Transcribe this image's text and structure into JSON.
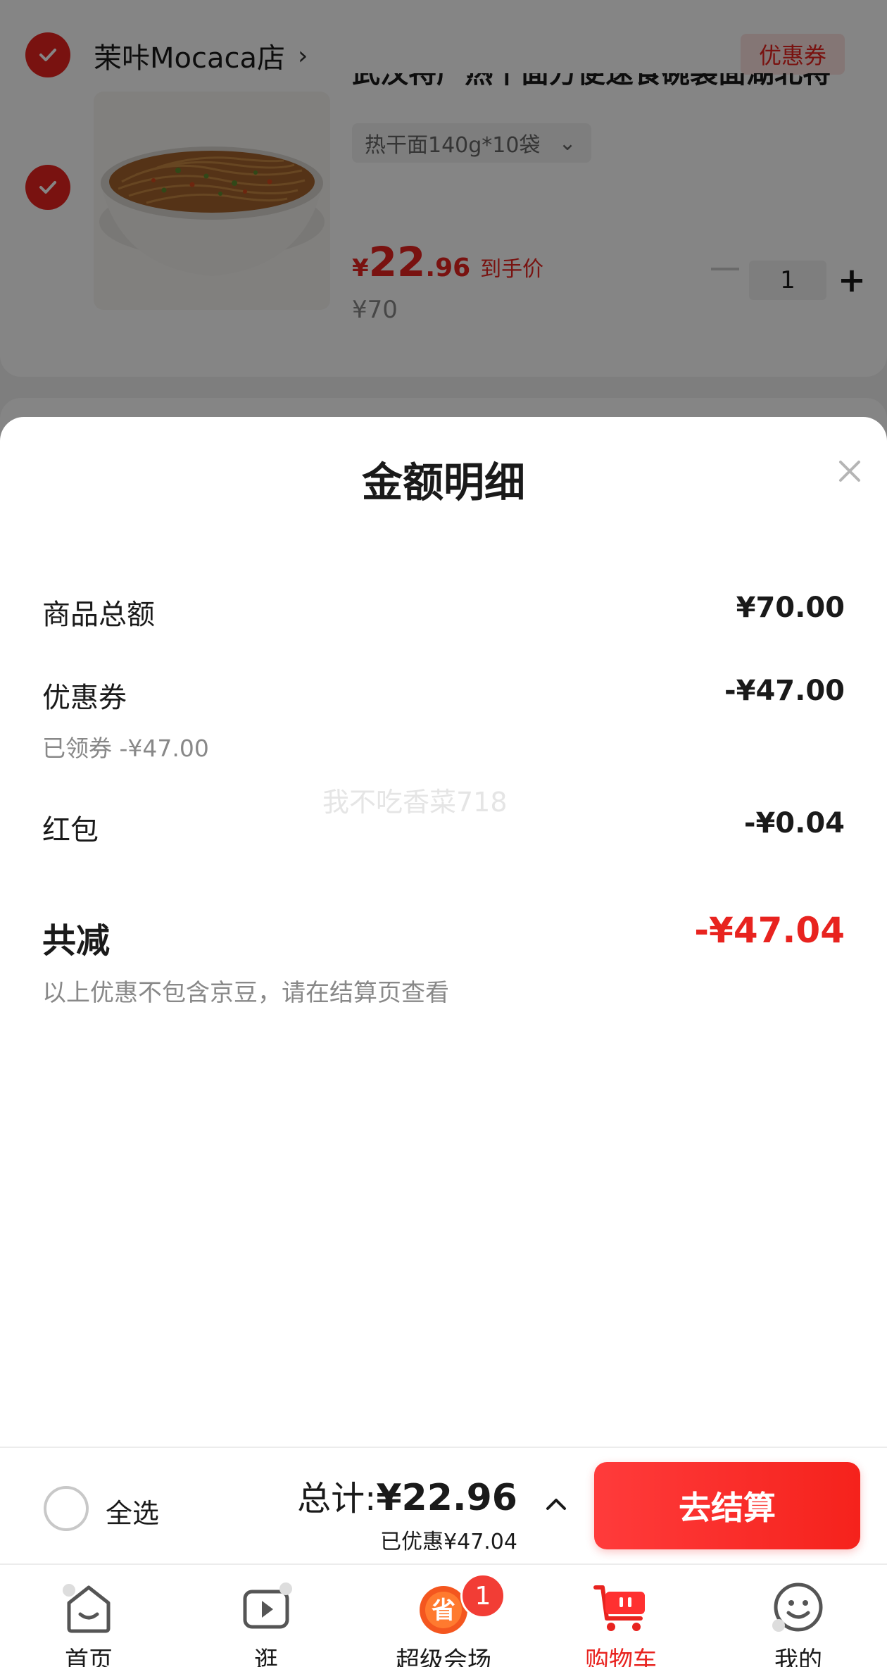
{
  "store": {
    "name": "茉咔Mocaca店",
    "chevron": "›",
    "coupon_tag": "优惠券"
  },
  "product": {
    "title": "武汉特产热干面方便速食碗装面湖北特",
    "spec": "热干面140g*10袋",
    "spec_chevron": "⌄",
    "price_yen": "¥",
    "price_int": "22",
    "price_dec": ".96",
    "price_note": "到手价",
    "original_price": "¥70",
    "quantity": "1",
    "plus": "+"
  },
  "sheet": {
    "title": "金额明细",
    "rows": [
      {
        "label": "商品总额",
        "value": "¥70.00"
      },
      {
        "label": "优惠券",
        "value": "-¥47.00",
        "sub": "已领券 -¥47.00"
      },
      {
        "label": "红包",
        "value": "-¥0.04"
      }
    ],
    "watermark": "我不吃香菜718",
    "total_label": "共减",
    "total_value": "-¥47.04",
    "footnote": "以上优惠不包含京豆，请在结算页查看"
  },
  "checkout": {
    "select_all": "全选",
    "sum_prefix": "总计:",
    "sum_amount": "¥22.96",
    "saved": "已优惠¥47.04",
    "button": "去结算"
  },
  "tabs": [
    {
      "label": "首页",
      "icon": "home-icon"
    },
    {
      "label": "逛",
      "icon": "video-play-icon"
    },
    {
      "label": "超级会场",
      "icon": "super-venue-icon",
      "badge": "1"
    },
    {
      "label": "购物车",
      "icon": "cart-icon",
      "active": true
    },
    {
      "label": "我的",
      "icon": "profile-smile-icon"
    }
  ],
  "colors": {
    "accent": "#e8231f",
    "overlay": "rgba(0,0,0,0.48)"
  }
}
